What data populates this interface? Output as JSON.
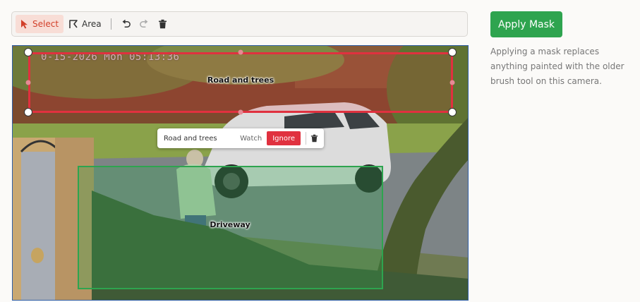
{
  "toolbar": {
    "select_label": "Select",
    "area_label": "Area",
    "active_tool": "select",
    "icons": [
      "cursor-arrow-icon",
      "area-polygon-icon",
      "undo-icon",
      "redo-icon",
      "trash-icon"
    ]
  },
  "camera": {
    "timestamp": "0-15-2026 Mon 05:13:36",
    "zones": [
      {
        "label": "Road and trees",
        "color": "#e0313f"
      },
      {
        "label": "Driveway",
        "color": "#2ea44f"
      }
    ]
  },
  "popup": {
    "zone_name": "Road and trees",
    "watch_label": "Watch",
    "ignore_label": "Ignore",
    "selected_action": "Ignore"
  },
  "panel": {
    "apply_label": "Apply Mask",
    "help_text": "Applying a mask replaces anything painted with the older brush tool on this camera.",
    "accent_color": "#2ea44f"
  }
}
